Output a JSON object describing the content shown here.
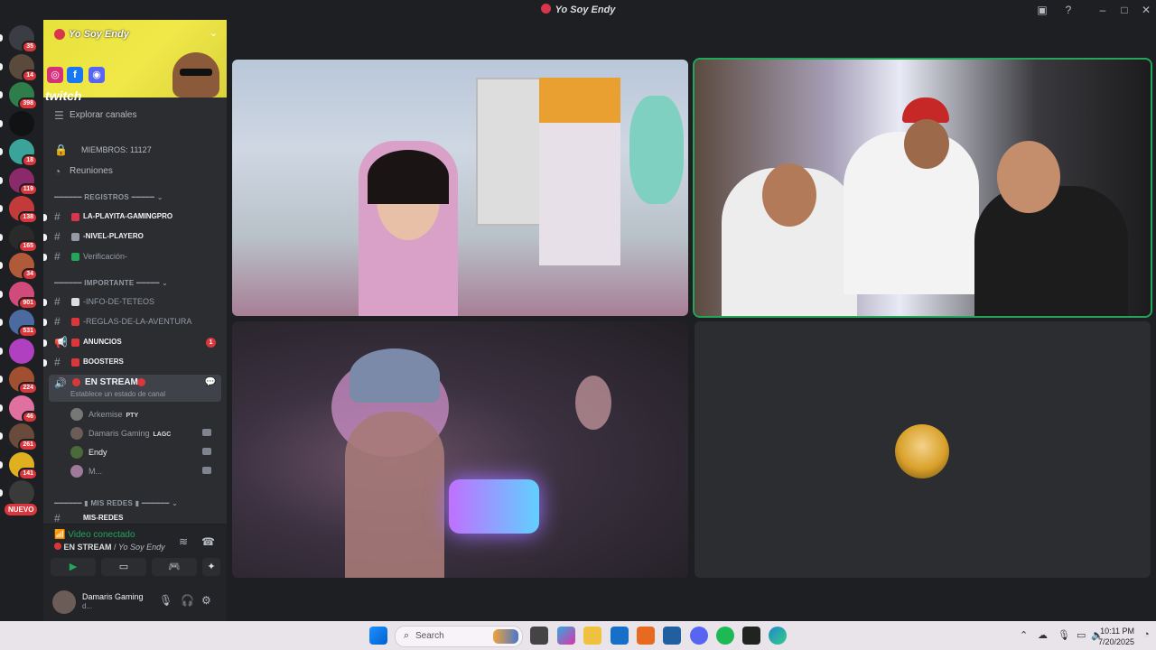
{
  "window": {
    "title": "Yo Soy Endy"
  },
  "guilds": [
    {
      "badge": "35",
      "color": "#3b3d44"
    },
    {
      "badge": "14",
      "color": "#5a4a3c"
    },
    {
      "badge": "398",
      "color": "#2e7d4a"
    },
    {
      "badge": "",
      "color": "#111214"
    },
    {
      "badge": "18",
      "color": "#3aa39a"
    },
    {
      "badge": "119",
      "color": "#8a2a6a"
    },
    {
      "badge": "138",
      "color": "#c23a3a"
    },
    {
      "badge": "165",
      "color": "#2a2a2a"
    },
    {
      "badge": "34",
      "color": "#b05a3a"
    },
    {
      "badge": "901",
      "color": "#d04a7a"
    },
    {
      "badge": "531",
      "color": "#4a6aa0"
    },
    {
      "badge": "",
      "color": "#b040c0"
    },
    {
      "badge": "224",
      "color": "#a05030"
    },
    {
      "badge": "46",
      "color": "#e070a0"
    },
    {
      "badge": "261",
      "color": "#6a4a3a"
    },
    {
      "badge": "141",
      "color": "#e0b020"
    },
    {
      "badge": "",
      "color": "#3a3a3a"
    }
  ],
  "nuevo_label": "NUEVO",
  "server": {
    "name": "Yo Soy Endy",
    "twitch": "twitch"
  },
  "nav": {
    "explore": "Explorar canales",
    "members": "MIEMBROS: 11127",
    "meetings": "Reuniones"
  },
  "channels": [
    {
      "type": "category",
      "label": "REGISTROS"
    },
    {
      "type": "text",
      "label": "LA-PLAYITA-GAMINGPRO",
      "bold": true,
      "emoji_color": "#d8364c"
    },
    {
      "type": "text",
      "label": "-NIVEL-PLAYERO",
      "bold": true,
      "emoji_color": "#949ba4"
    },
    {
      "type": "text",
      "label": "Verificación-",
      "bold": false,
      "emoji_color": "#23a55a"
    },
    {
      "type": "category",
      "label": "IMPORTANTE"
    },
    {
      "type": "text",
      "label": "-INFO-DE-TETEOS",
      "bold": false,
      "emoji_color": "#dbdee1"
    },
    {
      "type": "text",
      "label": "-REGLAS-DE-LA-AVENTURA",
      "bold": false,
      "emoji_color": "#da373c"
    },
    {
      "type": "announce",
      "label": "ANUNCIOS",
      "bold": true,
      "emoji_color": "#da373c",
      "count": "1"
    },
    {
      "type": "text",
      "label": "BOOSTERS",
      "bold": true,
      "emoji_color": "#da373c"
    }
  ],
  "voice_channel": {
    "name": "EN STREAM",
    "status_hint": "Establece un estado de canal"
  },
  "voice_users": [
    {
      "name": "Arkemise",
      "tag": "PTY",
      "color": "#777"
    },
    {
      "name": "Damaris Gaming",
      "tag": "LAGC",
      "color": "#6b5c57"
    },
    {
      "name": "Endy",
      "tag": "",
      "color": "#4a6a3a"
    },
    {
      "name": "M...",
      "tag": "",
      "color": "#a07a9a"
    }
  ],
  "category_mis_redes": "MIS REDES",
  "channel_mis_redes": "MIS-REDES",
  "voice_panel": {
    "status": "Video conectado",
    "channel": "EN STREAM",
    "server": "Yo Soy Endy"
  },
  "user": {
    "name": "Damaris Gaming",
    "status": "d..."
  },
  "taskbar": {
    "search_placeholder": "Search",
    "time": "10:11 PM",
    "date": "7/20/2025"
  },
  "colors": {
    "accent_green": "#23a55a",
    "alert_red": "#da373c",
    "sidebar_bg": "#2b2d31"
  }
}
